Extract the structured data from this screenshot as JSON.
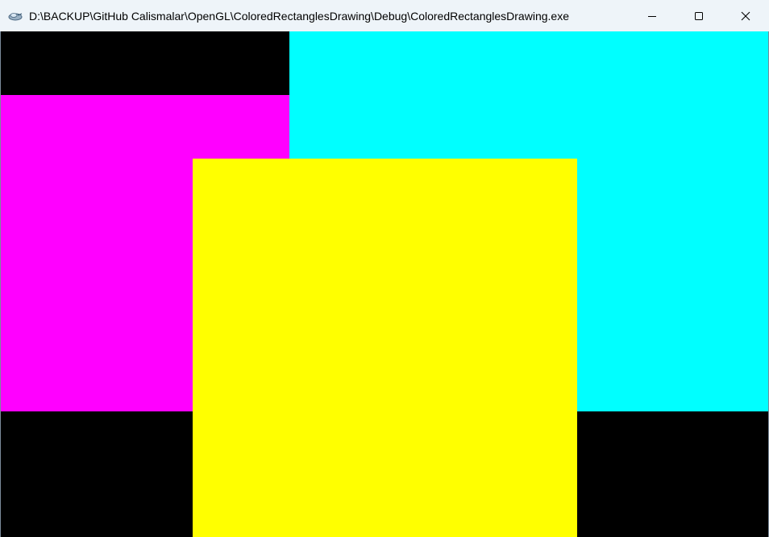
{
  "window": {
    "title": "D:\\BACKUP\\GitHub Calismalar\\OpenGL\\ColoredRectanglesDrawing\\Debug\\ColoredRectanglesDrawing.exe",
    "app_icon": "opengl-app-icon",
    "controls": {
      "minimize_icon": "minimize-icon",
      "maximize_icon": "maximize-icon",
      "close_icon": "close-icon"
    }
  },
  "canvas": {
    "background": "#000000",
    "rectangles": [
      {
        "name": "magenta-rectangle",
        "color": "#ff00ff"
      },
      {
        "name": "cyan-rectangle",
        "color": "#00ffff"
      },
      {
        "name": "yellow-rectangle",
        "color": "#ffff00"
      }
    ]
  }
}
